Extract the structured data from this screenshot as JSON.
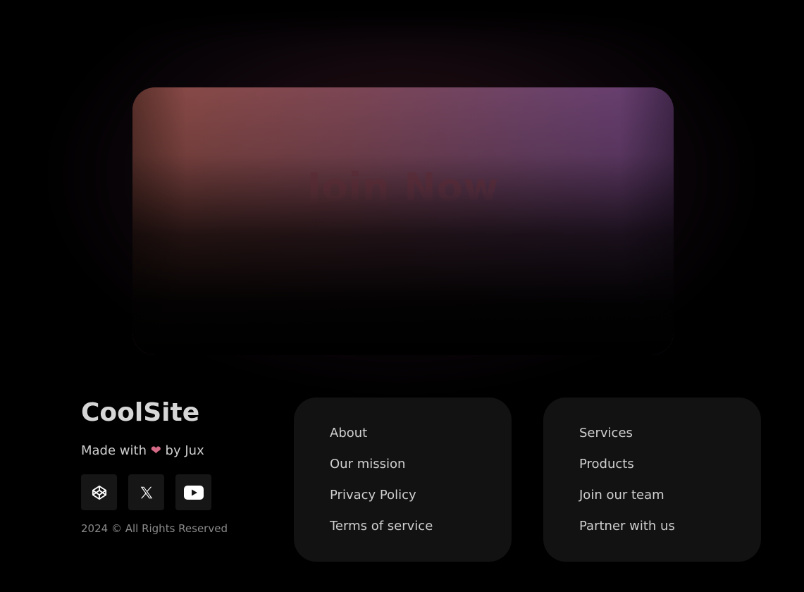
{
  "hero": {
    "cta_text": "Join Now"
  },
  "brand": {
    "name": "CoolSite",
    "made_with_prefix": "Made with",
    "made_with_suffix": "by Jux",
    "heart_icon": "heart-icon",
    "copyright": "2024 © All Rights Reserved"
  },
  "socials": [
    {
      "name": "codepen",
      "icon": "codepen-icon"
    },
    {
      "name": "x",
      "icon": "x-icon"
    },
    {
      "name": "youtube",
      "icon": "youtube-icon"
    }
  ],
  "links_left": [
    "About",
    "Our mission",
    "Privacy Policy",
    "Terms of service"
  ],
  "links_right": [
    "Services",
    "Products",
    "Join our team",
    "Partner with us"
  ],
  "colors": {
    "background": "#000000",
    "card": "#121212",
    "social_button": "#161616",
    "heart": "#d56a86",
    "hero_gradient_start": "#8a4a42",
    "hero_gradient_end": "#643c72"
  }
}
